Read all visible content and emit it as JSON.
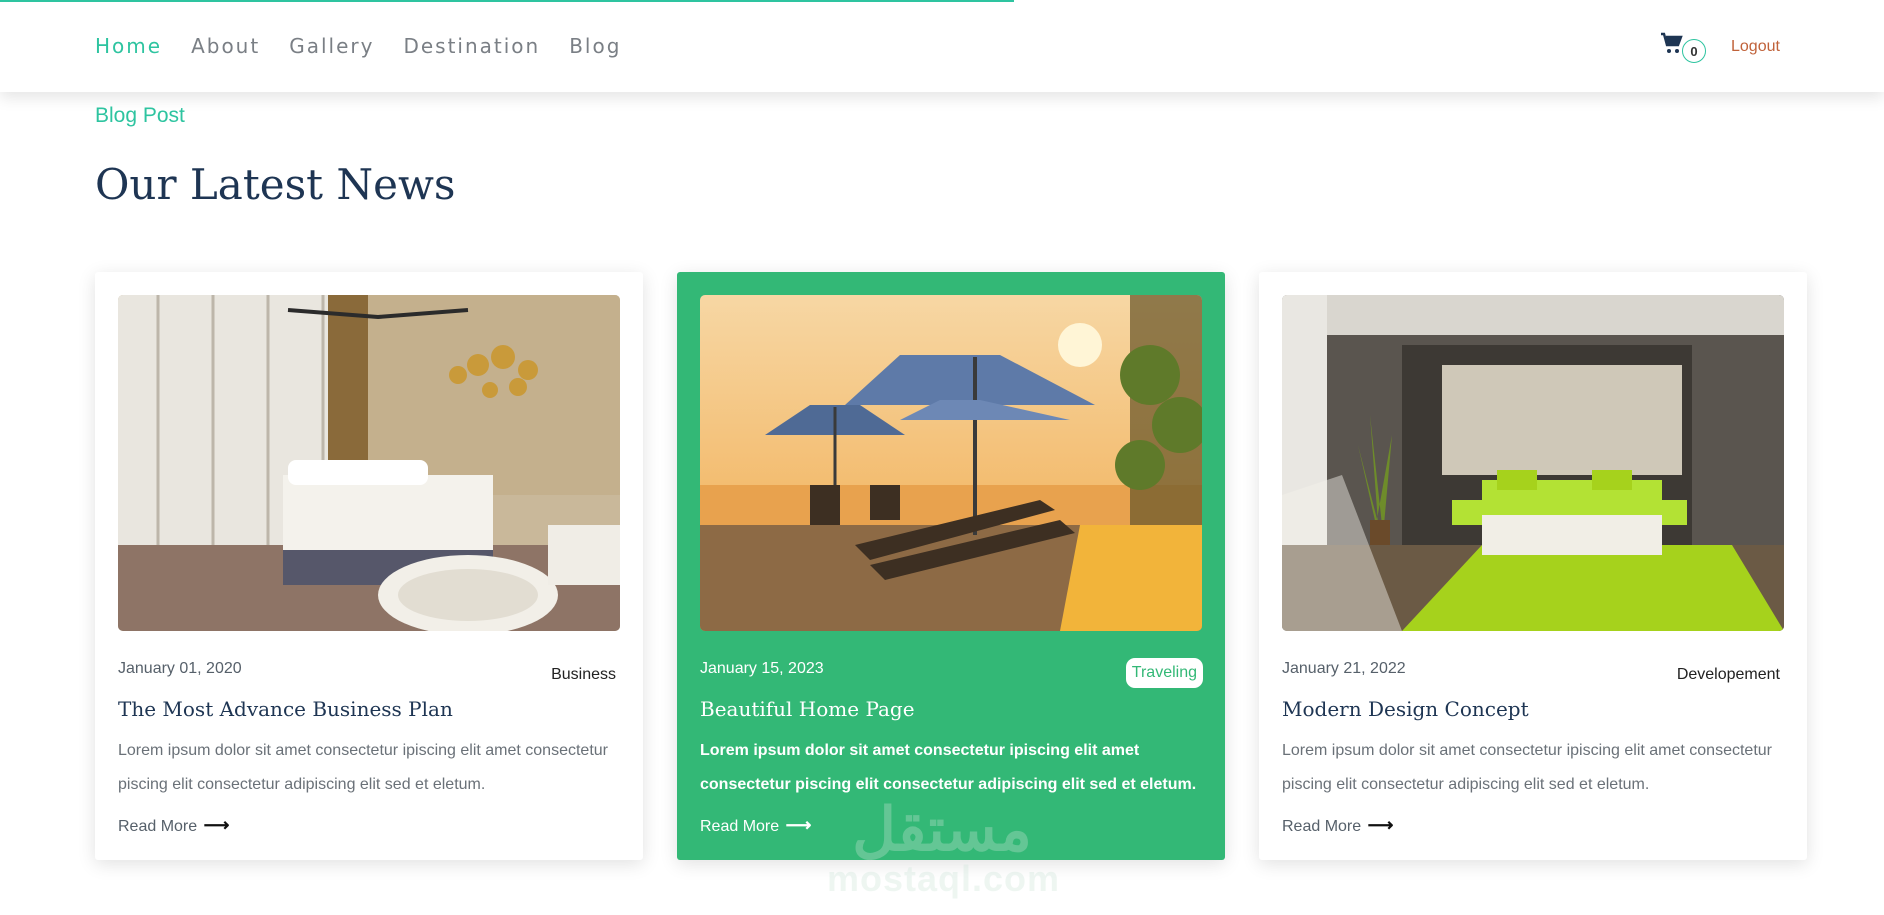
{
  "nav": {
    "items": [
      {
        "label": "Home",
        "active": true
      },
      {
        "label": "About"
      },
      {
        "label": "Gallery"
      },
      {
        "label": "Destination"
      },
      {
        "label": "Blog"
      }
    ],
    "cart_count": "0",
    "logout_label": "Logout"
  },
  "section": {
    "eyebrow": "Blog Post",
    "title": "Our Latest News"
  },
  "cards": [
    {
      "date": "January 01, 2020",
      "tag": "Business",
      "title": "The Most Advance Business Plan",
      "excerpt": "Lorem ipsum dolor sit amet consectetur ipiscing elit amet consectetur piscing elit consectetur adipiscing elit sed et eletum.",
      "link": "Read More",
      "featured": false
    },
    {
      "date": "January 15, 2023",
      "tag": "Traveling",
      "title": "Beautiful Home Page",
      "excerpt": "Lorem ipsum dolor sit amet consectetur ipiscing elit amet consectetur piscing elit consectetur adipiscing elit sed et eletum.",
      "link": "Read More",
      "featured": true
    },
    {
      "date": "January 21, 2022",
      "tag": "Developement",
      "title": "Modern Design Concept",
      "excerpt": "Lorem ipsum dolor sit amet consectetur ipiscing elit amet consectetur piscing elit consectetur adipiscing elit sed et eletum.",
      "link": "Read More",
      "featured": false
    }
  ],
  "watermark": {
    "logo": "مستقل",
    "text": "mostaql.com"
  },
  "colors": {
    "accent": "#2ec4a0",
    "featured_bg": "#33b876",
    "heading": "#1e3553",
    "logout": "#c0623a"
  },
  "icons": {
    "cart": "cart-icon",
    "arrow": "arrow-right-icon"
  }
}
